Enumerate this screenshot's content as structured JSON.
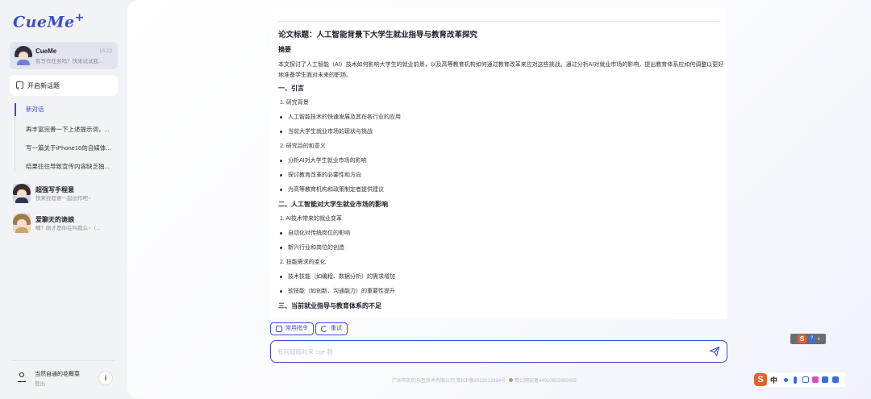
{
  "sidebar": {
    "logo": "CueMe",
    "active_agent": {
      "name": "CueMe",
      "time": "15:22",
      "subtitle": "有写作任务吗？快来试试我..."
    },
    "new_topic_label": "开启新话题",
    "history_title": "新对话",
    "history_items": [
      "再丰富完善一下上述提示词，...",
      "写一篇关于iPhone16的自媒体...",
      "结果往往导致宣传内容缺乏独..."
    ],
    "agents": [
      {
        "name": "超强写手程意",
        "subtitle": "快来找程意一起创作吧~"
      },
      {
        "name": "爱聊天的诡娘",
        "subtitle": "嘀？刚才是你在叫我么~（..."
      }
    ],
    "user": {
      "name": "当然自通的花椰菜",
      "logout": "登出",
      "info_icon": "info-icon"
    }
  },
  "document": {
    "title": "论文标题：人工智能背景下大学生就业指导与教育改革探究",
    "abstract_heading": "摘要",
    "abstract_text": "本文探讨了人工智能（AI）技术如何影响大学生的就业前景，以及高等教育机构如何通过教育改革来应对这些挑战。通过分析AI对就业市场的影响，提出教育体系应如何调整以更好地准备学生面对未来的职场。",
    "section1": {
      "heading": "一、引言",
      "n1": "1. 研究背景",
      "b1": [
        "人工智能技术的快速发展及其在各行业的应用",
        "当前大学生就业市场的现状与挑战"
      ],
      "n2": "2. 研究目的和意义",
      "b2": [
        "分析AI对大学生就业市场的影响",
        "探讨教育改革的必要性和方向",
        "为高等教育机构和政策制定者提供建议"
      ]
    },
    "section2": {
      "heading": "二、人工智能对大学生就业市场的影响",
      "n1": "1. AI技术带来的就业变革",
      "b1": [
        "自动化对传统岗位的影响",
        "新兴行业和岗位的创造"
      ],
      "n2": "2. 技能需求的变化",
      "b2": [
        "技术技能（如编程、数据分析）的需求增加",
        "软技能（如创新、沟通能力）的重要性提升"
      ]
    },
    "section3": {
      "heading": "三、当前就业指导与教育体系的不足"
    }
  },
  "actions": {
    "common_commands": "常用指令",
    "retry": "重试"
  },
  "input": {
    "placeholder": "有问题随时来 cue 我",
    "value": ""
  },
  "footer": {
    "company": "广州市的的乐互技术有限公司 粤ICP备2022013384号",
    "police": "粤公网安备44010502000055"
  },
  "ime": {
    "brand": "S",
    "mode": "中"
  },
  "colors": {
    "accent": "#3a4cc9",
    "background": "#f2f3f7"
  }
}
